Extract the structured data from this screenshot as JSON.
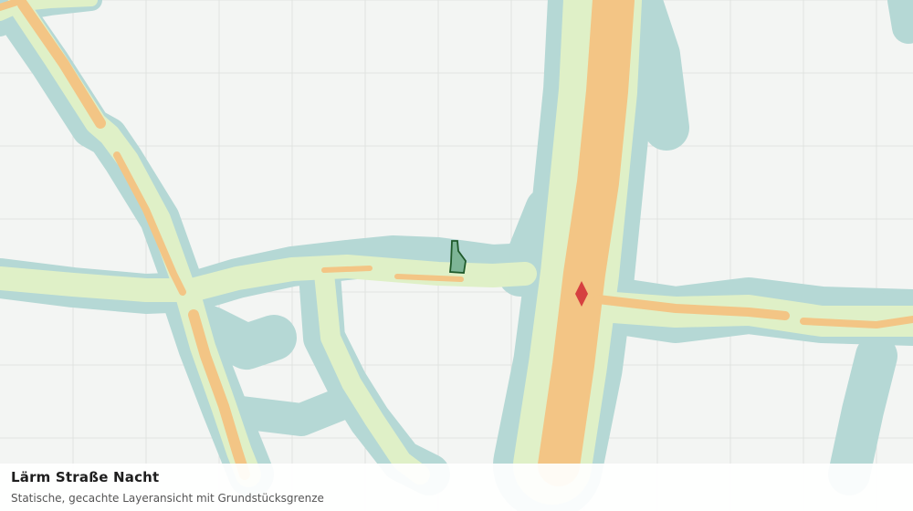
{
  "map": {
    "title": "Lärm Straße Nacht",
    "subtitle": "Statische, gecachte Layeransicht mit Grundstücksgrenze",
    "colors": {
      "background": "#f3f5f3",
      "grid": "#e0e3e0",
      "noise_low": "#b5d8d5",
      "noise_mid": "#dff0c7",
      "noise_high": "#f3c585",
      "parcel_fill": "#7db596",
      "parcel_stroke": "#1f5a2b",
      "marker": "#d64040"
    },
    "layers": [
      "noise-band-low",
      "noise-band-mid",
      "noise-band-high",
      "parcel-boundary",
      "location-marker"
    ]
  }
}
